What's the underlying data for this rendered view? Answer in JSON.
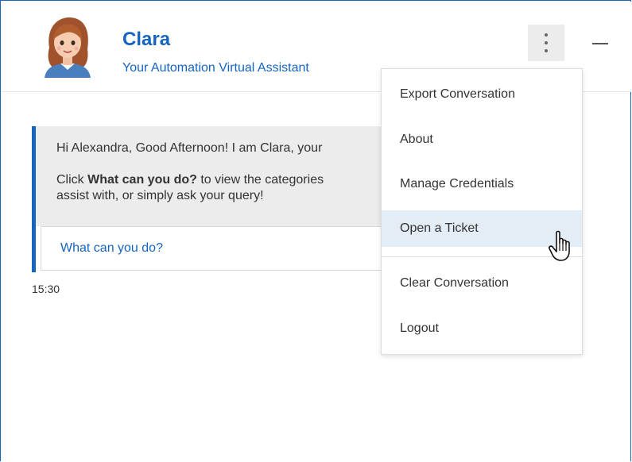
{
  "header": {
    "title": "Clara",
    "subtitle": "Your Automation Virtual Assistant",
    "avatar_icon": "avatar-icon",
    "kebab_icon": "kebab-menu-icon",
    "minimize_icon": "minimize-icon"
  },
  "message": {
    "line1": "Hi Alexandra, Good Afternoon! I am Clara, your",
    "line2_prefix": "Click ",
    "line2_bold": "What can you do?",
    "line2_suffix": " to view the categories",
    "line3": "assist with, or simply ask your query!",
    "chip": "What can you do?",
    "time": "15:30"
  },
  "menu": {
    "items": [
      {
        "label": "Export Conversation"
      },
      {
        "label": "About"
      },
      {
        "label": "Manage Credentials"
      },
      {
        "label": "Open a Ticket"
      },
      {
        "label": "Clear Conversation"
      },
      {
        "label": "Logout"
      }
    ],
    "hovered_index": 3
  },
  "colors": {
    "accent": "#1565c0",
    "bubble_bg": "#ececec",
    "hover_bg": "#e3edf6"
  }
}
